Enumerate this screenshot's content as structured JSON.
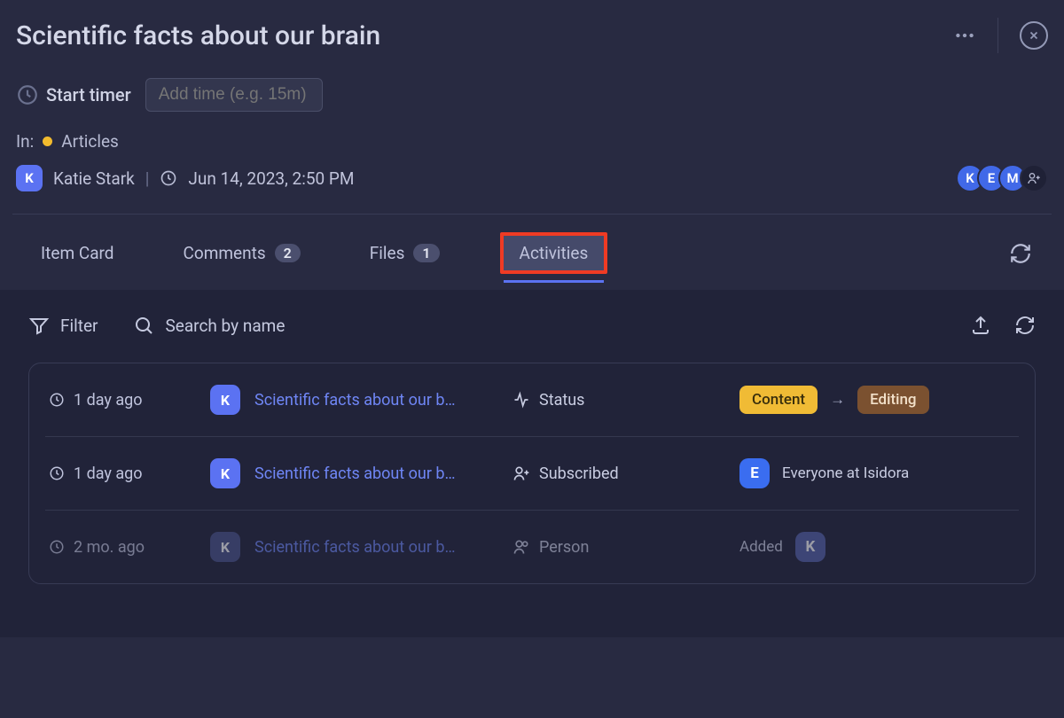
{
  "header": {
    "title": "Scientific facts about our brain"
  },
  "timer": {
    "start_label": "Start timer",
    "placeholder": "Add time (e.g. 15m)"
  },
  "meta": {
    "in_label": "In:",
    "category": "Articles",
    "author": "Katie Stark",
    "author_initial": "K",
    "timestamp": "Jun 14, 2023, 2:50 PM",
    "avatars": [
      "K",
      "E",
      "M"
    ]
  },
  "tabs": {
    "item_card": "Item Card",
    "comments": "Comments",
    "comments_count": "2",
    "files": "Files",
    "files_count": "1",
    "activities": "Activities"
  },
  "toolbar": {
    "filter": "Filter",
    "search_placeholder": "Search by name"
  },
  "activities": [
    {
      "time": "1 day ago",
      "actor": "K",
      "item": "Scientific facts about our b…",
      "type": "Status",
      "from_tag": "Content",
      "to_tag": "Editing"
    },
    {
      "time": "1 day ago",
      "actor": "K",
      "item": "Scientific facts about our b…",
      "type": "Subscribed",
      "value_avatar": "E",
      "value_text": "Everyone at Isidora"
    },
    {
      "time": "2 mo. ago",
      "actor": "K",
      "item": "Scientific facts about our b…",
      "type": "Person",
      "added_label": "Added",
      "added_avatar": "K"
    }
  ]
}
